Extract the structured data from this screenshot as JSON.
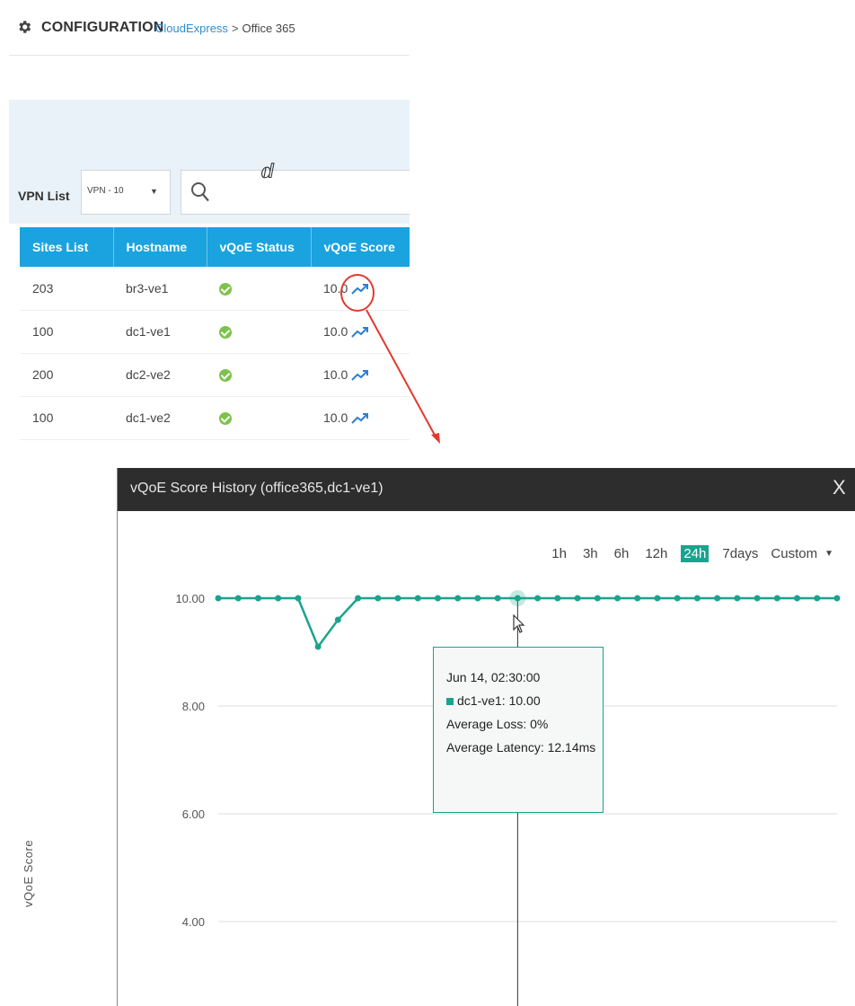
{
  "header": {
    "title": "CONFIGURATION",
    "breadcrumb_link": "CloudExpress",
    "breadcrumb_sep": ">",
    "breadcrumb_current": "Office 365"
  },
  "filter": {
    "vpn_label": "VPN List",
    "vpn_selected": "VPN - 10"
  },
  "table": {
    "columns": [
      "Sites List",
      "Hostname",
      "vQoE Status",
      "vQoE Score"
    ],
    "rows": [
      {
        "site": "203",
        "hostname": "br3-ve1",
        "score": "10.0"
      },
      {
        "site": "100",
        "hostname": "dc1-ve1",
        "score": "10.0"
      },
      {
        "site": "200",
        "hostname": "dc2-ve2",
        "score": "10.0"
      },
      {
        "site": "100",
        "hostname": "dc1-ve2",
        "score": "10.0"
      }
    ]
  },
  "modal": {
    "title": "vQoE Score History (office365,dc1-ve1)",
    "close": "X",
    "ranges": [
      "1h",
      "3h",
      "6h",
      "12h",
      "24h",
      "7days",
      "Custom"
    ],
    "active_range": "24h"
  },
  "tooltip": {
    "time": "Jun 14, 02:30:00",
    "series_line": "dc1-ve1: 10.00",
    "loss": "Average Loss: 0%",
    "latency": "Average Latency: 12.14ms"
  },
  "colors": {
    "accent": "#1aa3df",
    "series": "#1aa38f",
    "status_ok": "#7dc24b",
    "link": "#2b8fd1",
    "annotation": "#e03a2f"
  },
  "chart_data": {
    "type": "line",
    "title": "",
    "xlabel": "",
    "ylabel": "vQoE Score",
    "yticks": [
      "10.00",
      "8.00",
      "6.00",
      "4.00"
    ],
    "ylim": [
      3.6,
      10.5
    ],
    "grid": true,
    "series": [
      {
        "name": "dc1-ve1",
        "values": [
          10,
          10,
          10,
          10,
          10,
          9.1,
          9.6,
          10,
          10,
          10,
          10,
          10,
          10,
          10,
          10,
          10,
          10,
          10,
          10,
          10,
          10,
          10,
          10,
          10,
          10,
          10,
          10,
          10,
          10,
          10,
          10,
          10
        ]
      }
    ],
    "highlight_index": 15
  }
}
